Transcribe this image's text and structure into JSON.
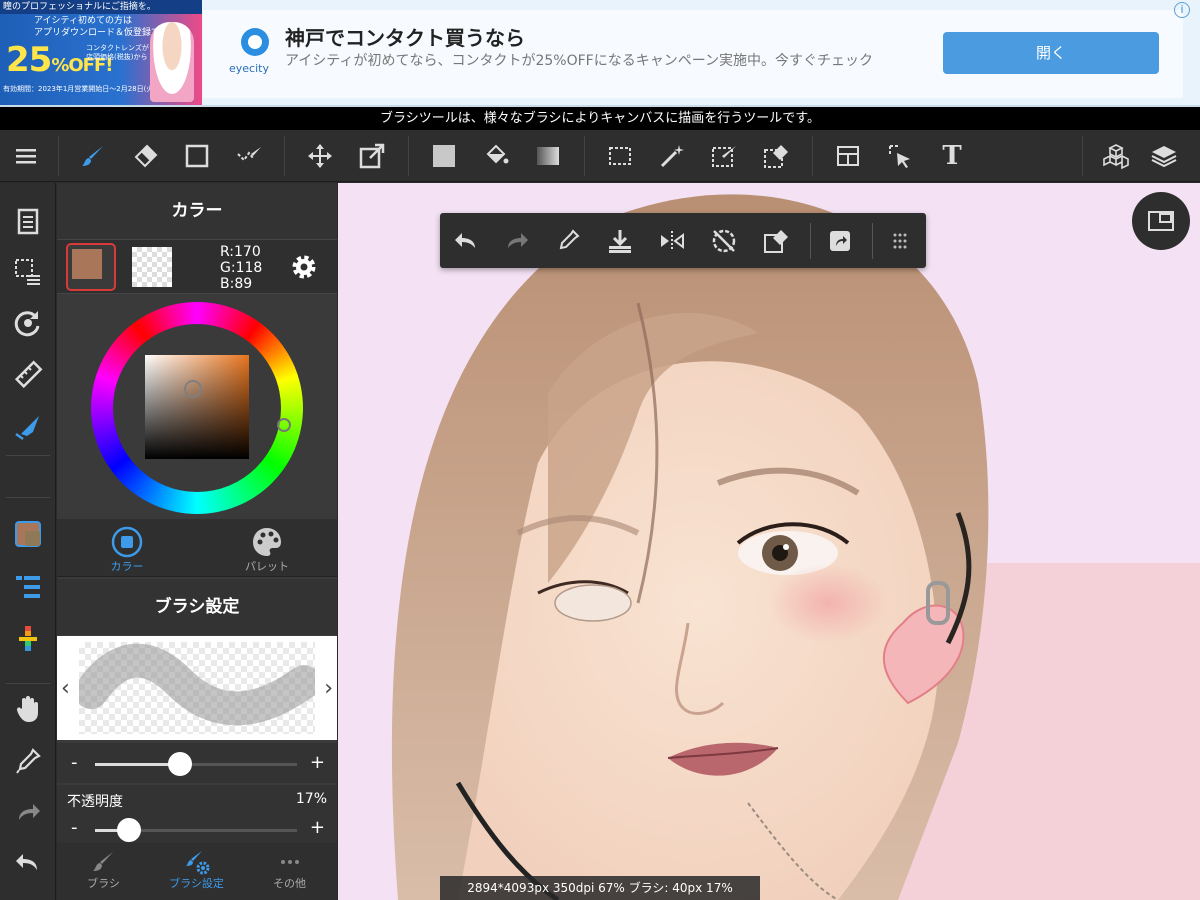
{
  "ad": {
    "image_strip": "瞳のプロフェッショナルにご指摘を。",
    "image_logo": "eyecity",
    "image_tag": "アイシティ初めての方は\nアプリダウンロード＆仮登録で",
    "image_discount": "25",
    "image_off": "%OFF!",
    "image_lens": "コンタクトレンズが\n店頭価格(税抜)から",
    "image_period": "有効期間：2023年1月営業開始日～2月28日(火)まで",
    "logo_text": "eyecity",
    "title": "神戸でコンタクト買うなら",
    "description": "アイシティが初めてなら、コンタクトが25%OFFになるキャンペーン実施中。今すぐチェック",
    "open_button": "開く",
    "info_icon": "i"
  },
  "tip": "ブラシツールは、様々なブラシによりキャンバスに描画を行うツールです。",
  "toolbar": {
    "text_tool_glyph": "T"
  },
  "panel": {
    "color_title": "カラー",
    "r": "R:170",
    "g": "G:118",
    "b": "B:89",
    "tab_color": "カラー",
    "tab_palette": "パレット",
    "brush_settings_title": "ブラシ設定",
    "minus": "-",
    "plus": "+",
    "size_slider_value": 0.42,
    "opacity_label": "不透明度",
    "opacity_value": "17%",
    "opacity_slider_value": 0.17,
    "btab_brush": "ブラシ",
    "btab_brush_settings": "ブラシ設定",
    "btab_more": "その他"
  },
  "canvas": {
    "status": "2894*4093px 350dpi 67% ブラシ: 40px 17%"
  },
  "colors": {
    "accent": "#3d9be9",
    "foreground": "#aa7659",
    "selected_border": "#d83a3a"
  }
}
